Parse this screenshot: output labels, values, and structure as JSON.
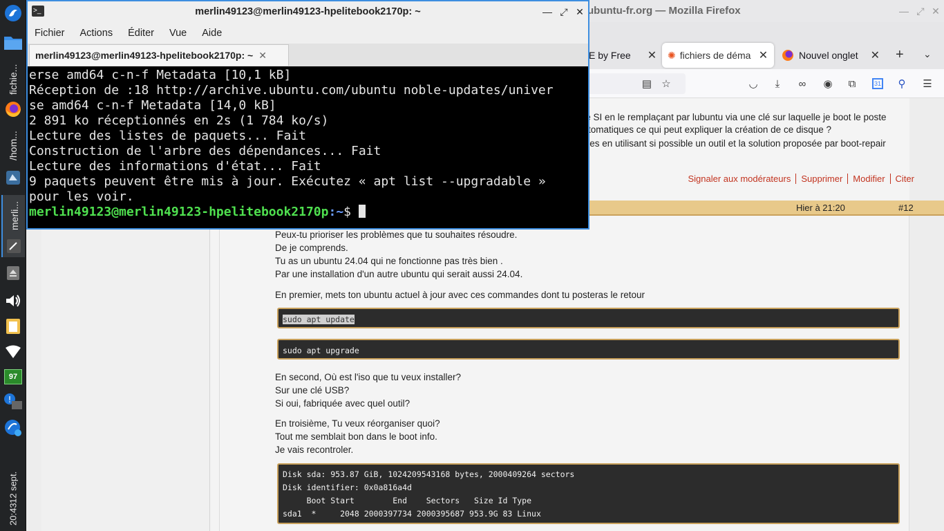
{
  "panel": {
    "tasks": [
      {
        "label": "fichie..."
      },
      {
        "label": "/hom..."
      },
      {
        "label": "merli..."
      }
    ],
    "battery_level": "97",
    "clock": {
      "time": "20:43",
      "date": "12 sept."
    }
  },
  "firefox": {
    "title": "ubuntu-fr.org — Mozilla Firefox",
    "tabs": [
      {
        "label": "E by Free"
      },
      {
        "label": "fichiers de déma"
      },
      {
        "label": "Nouvel onglet"
      }
    ],
    "forum": {
      "prev_post_lines": [
        "r le SI en le remplaçant par lubuntu via une clé sur laquelle je boot le poste",
        "automatiques ce qui peut expliquer la création de ce disque ?",
        "utiles en utilisant si possible un outil et la solution proposée par boot-repair"
      ],
      "post_actions": [
        "Signaler aux modérateurs",
        "Supprimer",
        "Modifier",
        "Citer"
      ],
      "post_header": {
        "date": "Hier à 21:20",
        "number": "#12"
      },
      "paragraphs": [
        [
          "Peux-tu prioriser les problèmes que tu souhaites résoudre.",
          "De je comprends.",
          "Tu as un ubuntu 24.04 qui ne fonctionne pas très  bien .",
          "Par une installation d'un autre ubuntu qui serait aussi 24.04."
        ],
        [
          "En premier, mets ton ubuntu actuel à jour avec ces commandes dont tu posteras le retour"
        ],
        [
          "En second, Où est l'iso que tu veux installer?",
          "Sur une clé  USB?",
          "Si oui, fabriquée avec quel outil?"
        ],
        [
          "En troisième, Tu veux réorganiser quoi?",
          "Tout me semblait bon dans le boot info.",
          "Je vais recontroler."
        ]
      ],
      "code1": "sudo apt update",
      "code2": "sudo apt upgrade",
      "code3": [
        "Disk sda: 953.87 GiB, 1024209543168 bytes, 2000409264 sectors",
        "Disk identifier: 0x0a816a4d",
        "     Boot Start        End    Sectors   Size Id Type",
        "sda1  *     2048 2000397734 2000395687 953.9G 83 Linux"
      ]
    }
  },
  "terminal": {
    "title": "merlin49123@merlin49123-hpelitebook2170p: ~",
    "menu": [
      "Fichier",
      "Actions",
      "Éditer",
      "Vue",
      "Aide"
    ],
    "tab_label": "merlin49123@merlin49123-hpelitebook2170p: ~",
    "lines": [
      "erse amd64 c-n-f Metadata [10,1 kB]",
      "Réception de :18 http://archive.ubuntu.com/ubuntu noble-updates/univer",
      "se amd64 c-n-f Metadata [14,0 kB]",
      "2 891 ko réceptionnés en 2s (1 784 ko/s)",
      "Lecture des listes de paquets... Fait",
      "Construction de l'arbre des dépendances... Fait",
      "Lecture des informations d'état... Fait",
      "9 paquets peuvent être mis à jour. Exécutez « apt list --upgradable »",
      "pour les voir."
    ],
    "prompt_user": "merlin49123@merlin49123-hpelitebook2170p",
    "prompt_path": ":~",
    "prompt_symbol": "$ "
  }
}
